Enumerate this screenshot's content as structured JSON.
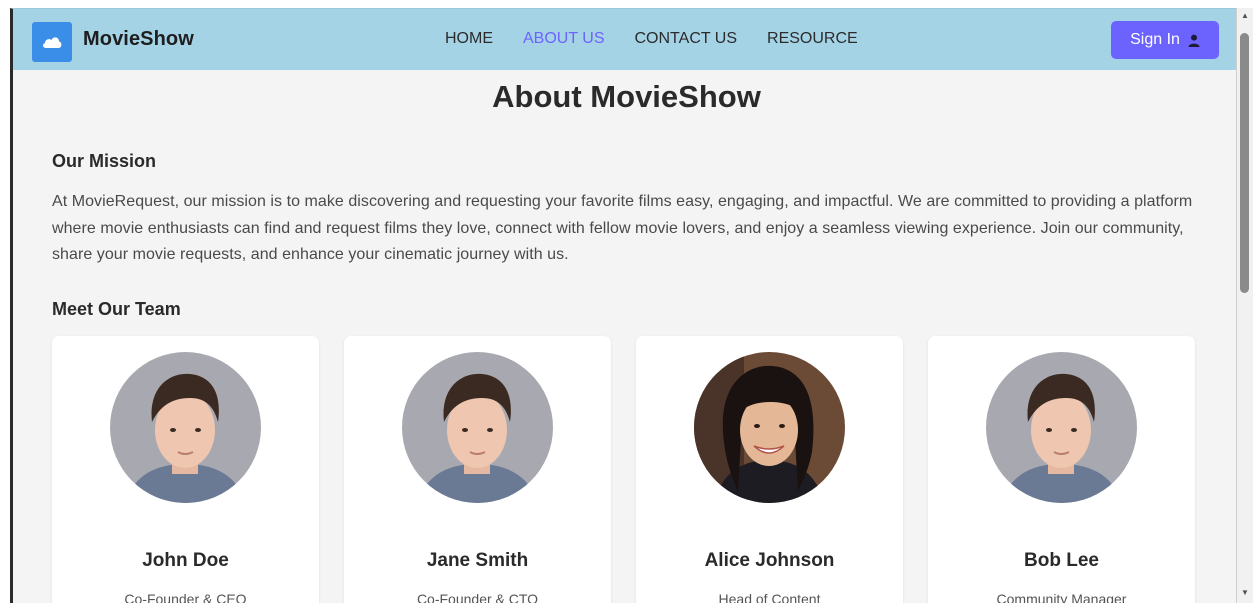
{
  "navbar": {
    "brand": "MovieShow",
    "logo_icon": "cloud-icon",
    "links": [
      "HOME",
      "ABOUT US",
      "CONTACT US",
      "RESOURCE"
    ],
    "active_link": "ABOUT US",
    "signin_label": "Sign In",
    "signin_icon": "user-icon",
    "bg_color": "#a5d3e6",
    "accent_color": "#6c63ff"
  },
  "page": {
    "title": "About MovieShow",
    "mission_heading": "Our Mission",
    "mission_text": "At MovieRequest, our mission is to make discovering and requesting your favorite films easy, engaging, and impactful. We are committed to providing a platform where movie enthusiasts can find and request films they love, connect with fellow movie lovers, and enjoy a seamless viewing experience. Join our community, share your movie requests, and enhance your cinematic journey with us.",
    "team_heading": "Meet Our Team"
  },
  "team": [
    {
      "name": "John Doe",
      "role": "Co-Founder & CEO"
    },
    {
      "name": "Jane Smith",
      "role": "Co-Founder & CTO"
    },
    {
      "name": "Alice Johnson",
      "role": "Head of Content"
    },
    {
      "name": "Bob Lee",
      "role": "Community Manager"
    }
  ]
}
